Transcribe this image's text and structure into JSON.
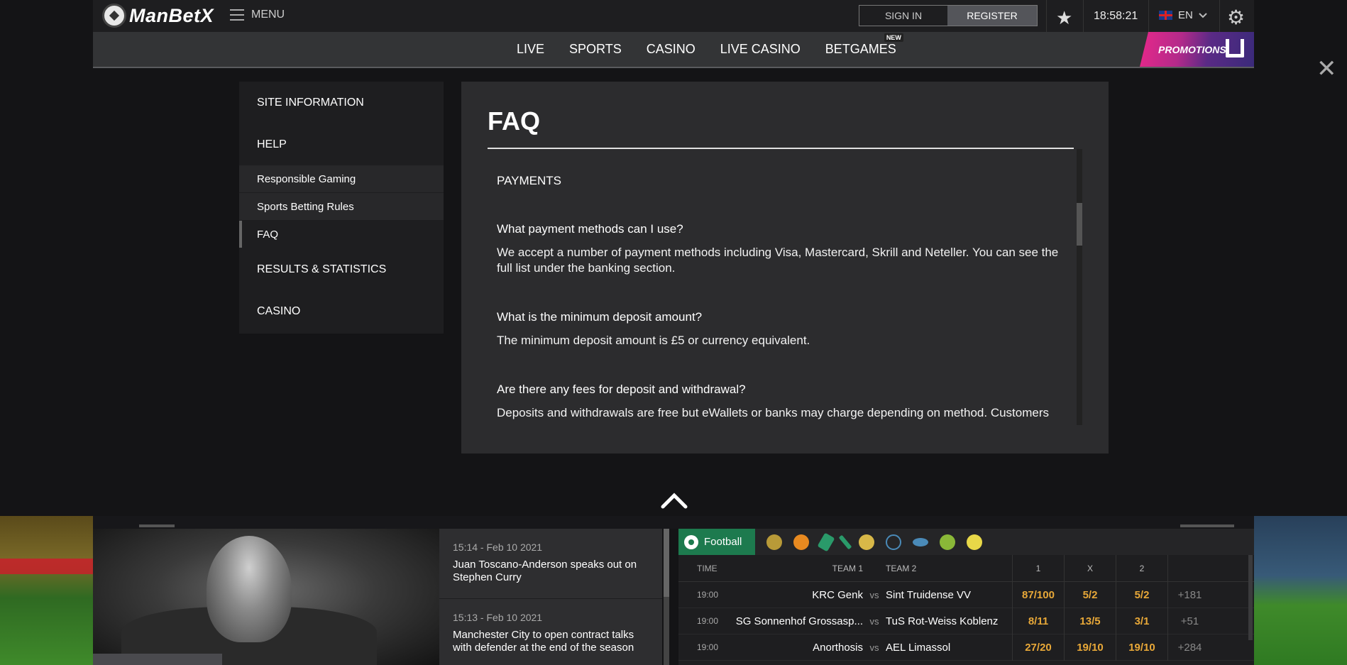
{
  "header": {
    "logo_text": "ManBetX",
    "menu_label": "MENU",
    "sign_in": "SIGN IN",
    "register": "REGISTER",
    "time": "18:58:21",
    "language": "EN"
  },
  "nav": {
    "items": [
      {
        "label": "LIVE"
      },
      {
        "label": "SPORTS"
      },
      {
        "label": "CASINO"
      },
      {
        "label": "LIVE CASINO"
      },
      {
        "label": "BETGAMES",
        "badge": "NEW"
      }
    ],
    "promotions": "PROMOTIONS"
  },
  "sidebar": {
    "site_information": "SITE INFORMATION",
    "help": "HELP",
    "help_items": [
      "Responsible Gaming",
      "Sports Betting Rules",
      "FAQ"
    ],
    "results": "RESULTS & STATISTICS",
    "casino": "CASINO"
  },
  "faq": {
    "title": "FAQ",
    "section": "PAYMENTS",
    "items": [
      {
        "q": "What payment methods can I use?",
        "a": "We accept a number of payment methods including Visa, Mastercard, Skrill and Neteller. You can see the full list under the banking section."
      },
      {
        "q": "What is the minimum deposit amount?",
        "a": "The minimum deposit amount is £5 or currency equivalent."
      },
      {
        "q": "Are there any fees for deposit and withdrawal?",
        "a": "Deposits and withdrawals are free but eWallets or banks may charge depending on method. Customers"
      }
    ]
  },
  "news": [
    {
      "time": "15:14 - Feb 10 2021",
      "headline": "Juan Toscano-Anderson speaks out on Stephen Curry"
    },
    {
      "time": "15:13 - Feb 10 2021",
      "headline": "Manchester City to open contract talks with defender at the end of the season"
    }
  ],
  "odds": {
    "active_sport": "Football",
    "headers": {
      "time": "TIME",
      "team1": "TEAM 1",
      "team2": "TEAM 2",
      "o1": "1",
      "ox": "X",
      "o2": "2"
    },
    "rows": [
      {
        "time": "19:00",
        "team1": "KRC Genk",
        "vs": "vs",
        "team2": "Sint Truidense VV",
        "o1": "87/100",
        "ox": "5/2",
        "o2": "5/2",
        "more": "+181"
      },
      {
        "time": "19:00",
        "team1": "SG Sonnenhof Grossasp...",
        "vs": "vs",
        "team2": "TuS Rot-Weiss Koblenz",
        "o1": "8/11",
        "ox": "13/5",
        "o2": "3/1",
        "more": "+51"
      },
      {
        "time": "19:00",
        "team1": "Anorthosis",
        "vs": "vs",
        "team2": "AEL Limassol",
        "o1": "27/20",
        "ox": "19/10",
        "o2": "19/10",
        "more": "+284"
      }
    ]
  },
  "colors": {
    "accent_green": "#1d7a4e",
    "odds_orange": "#e8a838",
    "promo_pink": "#e8288a"
  }
}
